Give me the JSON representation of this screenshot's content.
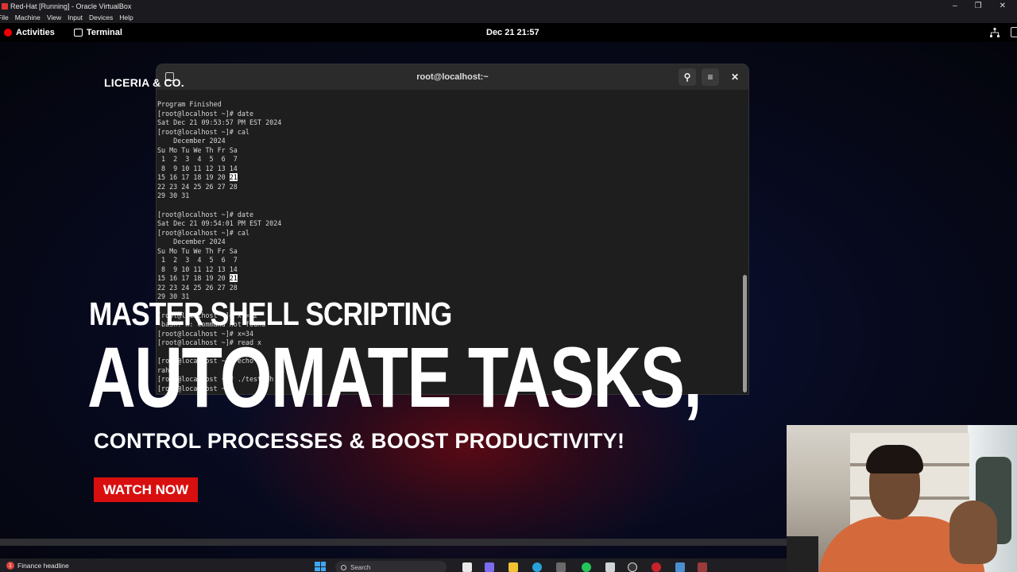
{
  "vbox": {
    "window_title": "Red-Hat [Running] - Oracle VirtualBox",
    "menu": [
      "File",
      "Machine",
      "View",
      "Input",
      "Devices",
      "Help"
    ],
    "controls": [
      "–",
      "❐",
      "✕"
    ]
  },
  "gnome": {
    "activities": "Activities",
    "app_name": "Terminal",
    "clock": "Dec 21  21:57"
  },
  "terminal": {
    "title": "root@localhost:~",
    "search_glyph": "⚲",
    "menu_glyph": "≡",
    "close_glyph": "✕",
    "lines": [
      "Program Finished",
      "[root@localhost ~]# date",
      "Sat Dec 21 09:53:57 PM EST 2024",
      "[root@localhost ~]# cal",
      "    December 2024",
      "Su Mo Tu We Th Fr Sa",
      " 1  2  3  4  5  6  7",
      " 8  9 10 11 12 13 14",
      "15 16 17 18 19 20 21",
      "22 23 24 25 26 27 28",
      "29 30 31",
      "",
      "[root@localhost ~]# date",
      "Sat Dec 21 09:54:01 PM EST 2024",
      "[root@localhost ~]# cal",
      "    December 2024",
      "Su Mo Tu We Th Fr Sa",
      " 1  2  3  4  5  6  7",
      " 8  9 10 11 12 13 14",
      "15 16 17 18 19 20 21",
      "22 23 24 25 26 27 28",
      "29 30 31",
      "",
      "[root@localhost ~]# x = 2",
      "-bash: x: command not found",
      "[root@localhost ~]# x=34",
      "[root@localhost ~]# read x",
      "",
      "[root@localhost ~]# echo",
      "rahul",
      "[root@localhost ~]# ./test.sh",
      "[root@localhost ~]#"
    ],
    "highlight_day": "21",
    "scroll_fraction": 0.61
  },
  "overlay": {
    "brand": "LICERIA & CO.",
    "headline_small": "MASTER SHELL SCRIPTING",
    "headline_large": "AUTOMATE TASKS,",
    "subheadline": "CONTROL PROCESSES & BOOST PRODUCTIVITY!",
    "cta": "WATCH NOW",
    "cta_color": "#d90f0f"
  },
  "taskbar": {
    "news_badge": "1",
    "news_label": "Finance headline",
    "search_placeholder": "Search"
  }
}
